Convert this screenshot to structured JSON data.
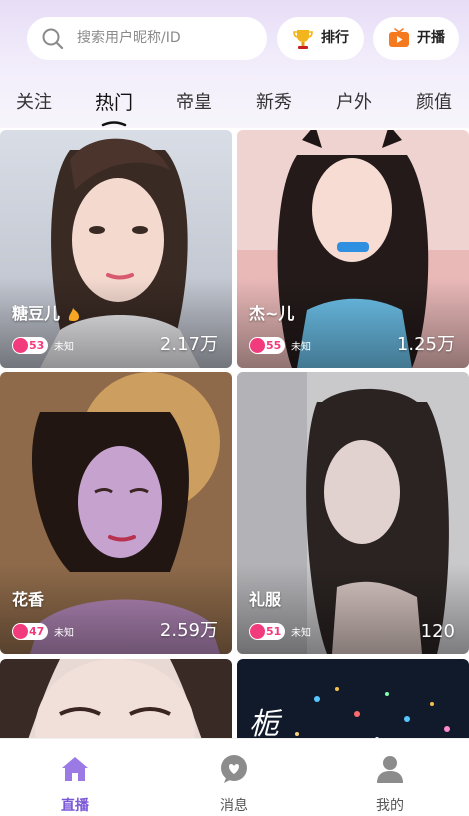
{
  "search": {
    "placeholder": "搜索用户昵称/ID"
  },
  "header_buttons": {
    "rank_label": "排行",
    "live_label": "开播"
  },
  "tabs": [
    "关注",
    "热门",
    "帝皇",
    "新秀",
    "户外",
    "颜值"
  ],
  "active_tab": "热门",
  "cards": [
    {
      "name": "糖豆儿",
      "level": "53",
      "location": "未知",
      "views": "2.17万"
    },
    {
      "name": "杰~儿",
      "level": "55",
      "location": "未知",
      "views": "1.25万"
    },
    {
      "name": "花香",
      "level": "47",
      "location": "未知",
      "views": "2.59万"
    },
    {
      "name": "礼服",
      "level": "51",
      "location": "未知",
      "views": "120"
    }
  ],
  "partial_card_text": "栀",
  "bottom_nav": [
    {
      "label": "直播",
      "icon": "home-icon"
    },
    {
      "label": "消息",
      "icon": "message-heart-icon"
    },
    {
      "label": "我的",
      "icon": "user-icon"
    }
  ],
  "colors": {
    "accent": "#7a57d8",
    "level_badge": "#f23b7c",
    "header_gradient_top": "#e7ddf6"
  }
}
